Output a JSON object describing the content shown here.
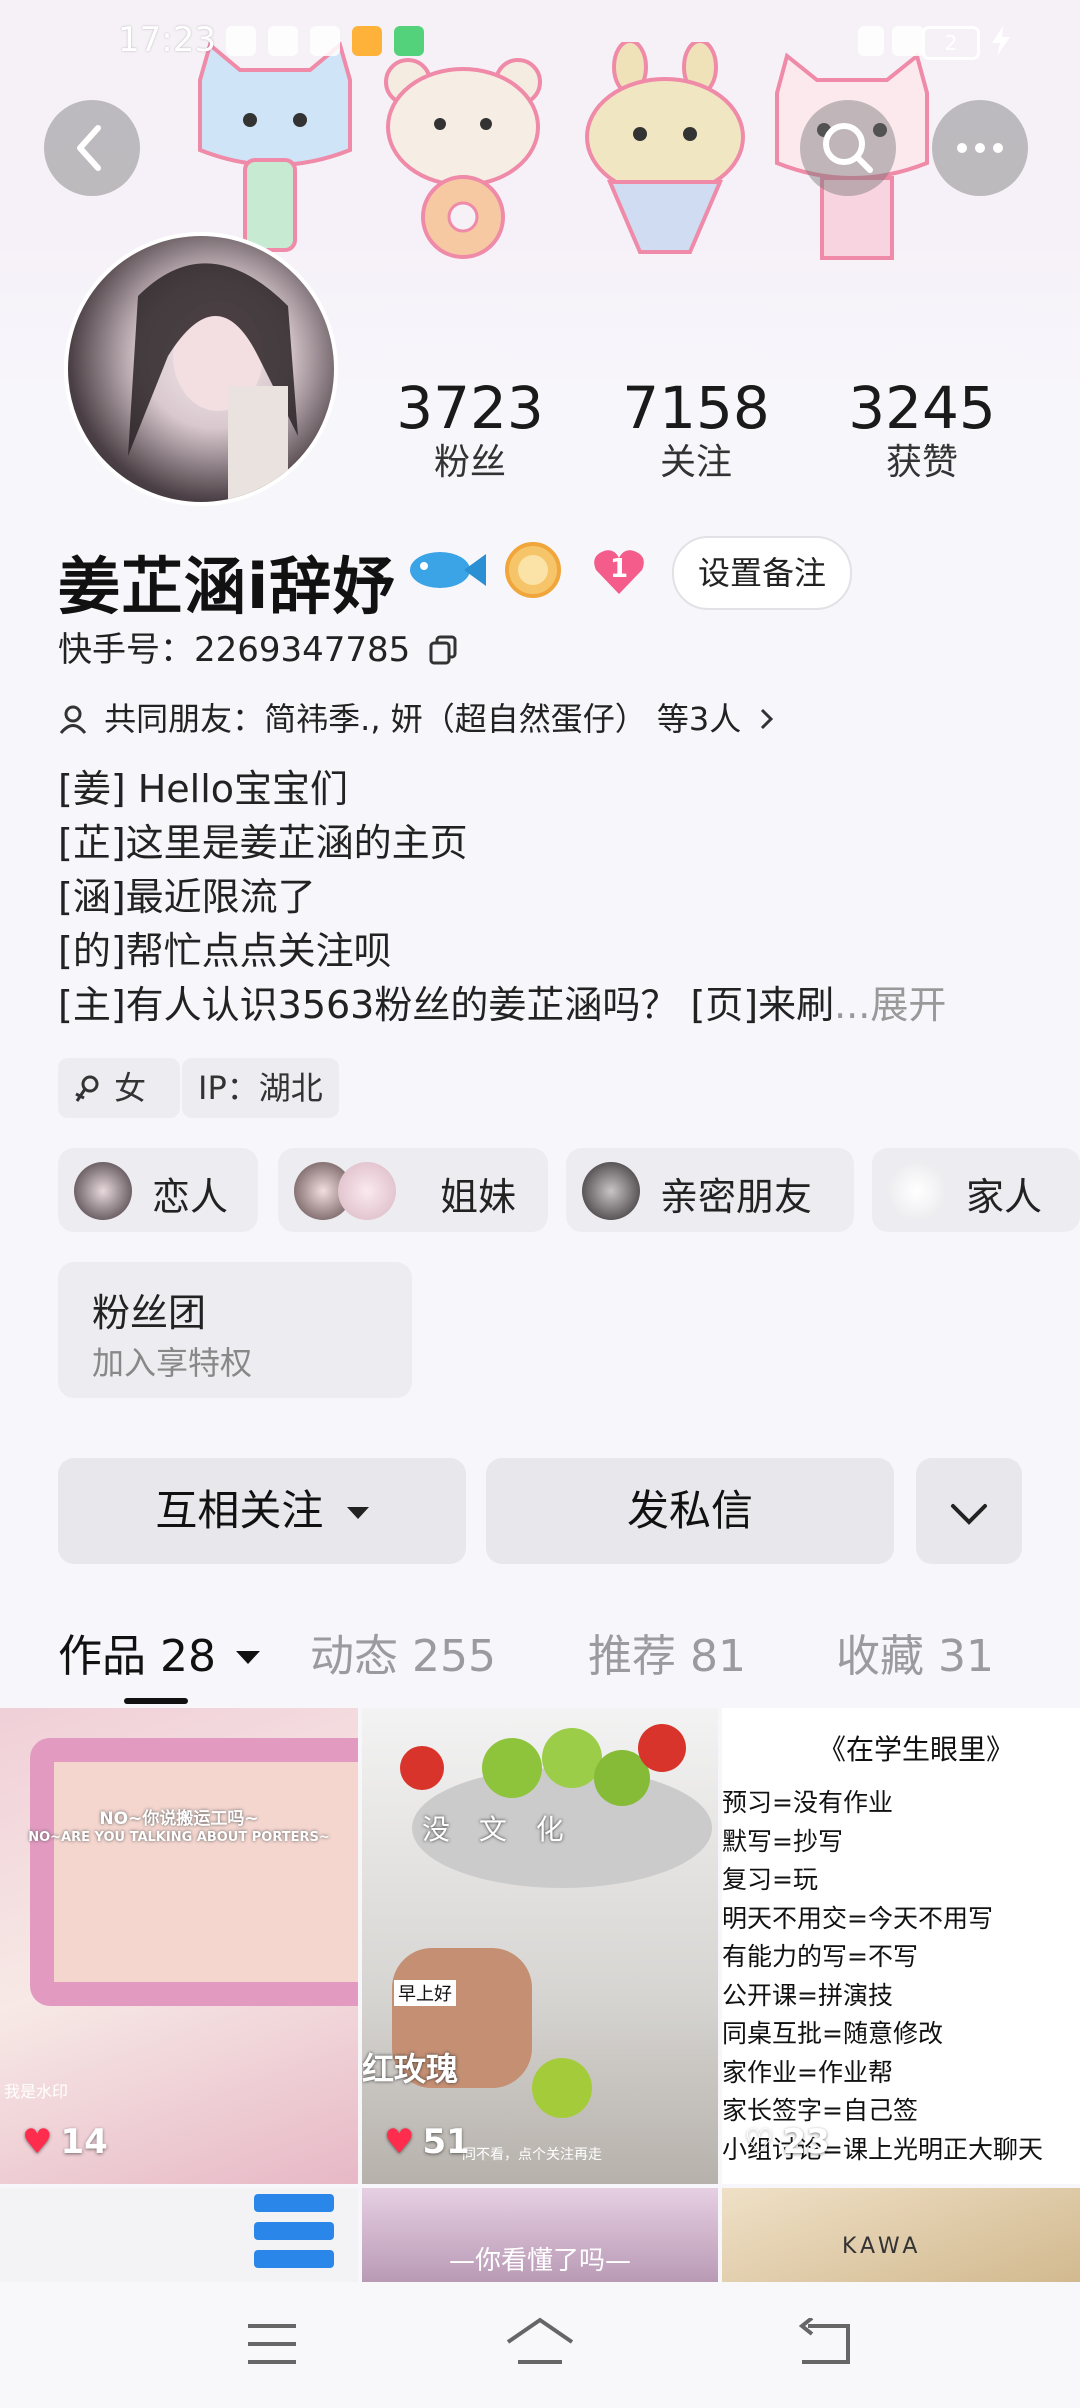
{
  "status_bar": {
    "time": "17:23",
    "battery": "2"
  },
  "header": {
    "back_icon": "back-icon",
    "search_icon": "search-icon",
    "more_icon": "more-icon"
  },
  "profile": {
    "stats": [
      {
        "value": "3723",
        "label": "粉丝"
      },
      {
        "value": "7158",
        "label": "关注"
      },
      {
        "value": "3245",
        "label": "获赞"
      }
    ],
    "name": "姜芷涵i辞妤",
    "heart_badge_count": "1",
    "remark_button": "设置备注",
    "kuaishou_id": "快手号：2269347785",
    "mutual_friends": "共同朋友：简祎季., 妍（超自然蛋仔） 等3人",
    "bio_lines": [
      "[姜] Hello宝宝们",
      "[芷]这里是姜芷涵的主页",
      "[涵]最近限流了",
      "[的]帮忙点点关注呗",
      "[主]有人认识3563粉丝的姜芷涵吗？ [页]来刷"
    ],
    "bio_more": "...展开",
    "tags": {
      "gender": "女",
      "ip": "IP：湖北"
    }
  },
  "relations": [
    {
      "label": "恋人"
    },
    {
      "label": "姐妹"
    },
    {
      "label": "亲密朋友"
    },
    {
      "label": "家人"
    }
  ],
  "fan_group": {
    "title": "粉丝团",
    "subtitle": "加入享特权"
  },
  "actions": {
    "follow": "互相关注",
    "message": "发私信"
  },
  "tabs": [
    {
      "label": "作品 28"
    },
    {
      "label": "动态 255"
    },
    {
      "label": "推荐 81"
    },
    {
      "label": "收藏 31"
    }
  ],
  "grid": {
    "item1": {
      "likes": "14",
      "caption1": "NO~你说搬运工吗~",
      "caption2": "NO~ARE YOU TALKING ABOUT PORTERS~",
      "side": "我是水印"
    },
    "item2": {
      "likes": "51",
      "overlay": "没 文 化",
      "small": "早上好",
      "bottom": "红玫瑰",
      "tiny": "同不看，点个关注再走"
    },
    "item3": {
      "likes": "23",
      "title": "《在学生眼里》",
      "lines": [
        "预习=没有作业",
        "默写=抄写",
        "复习=玩",
        "明天不用交=今天不用写",
        "有能力的写=不写",
        "公开课=拼演技",
        "同桌互批=随意修改",
        "家作业=作业帮",
        "家长签字=自己签",
        "小组讨论=课上光明正大聊天"
      ]
    },
    "item5": {
      "caption": "—你看懂了吗—"
    },
    "item6": {
      "caption": "KAWA"
    }
  }
}
